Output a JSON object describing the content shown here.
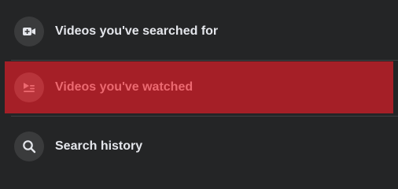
{
  "menu": {
    "items": [
      {
        "label": "Videos you've searched for",
        "icon": "video-camera-plus-icon",
        "selected": false
      },
      {
        "label": "Videos you've watched",
        "icon": "video-list-icon",
        "selected": true
      },
      {
        "label": "Search history",
        "icon": "search-icon",
        "selected": false
      }
    ]
  },
  "colors": {
    "background": "#242526",
    "icon_circle": "#3a3b3c",
    "text": "#e4e6eb",
    "selected_background": "#a51f27",
    "selected_text": "#ec6970"
  }
}
